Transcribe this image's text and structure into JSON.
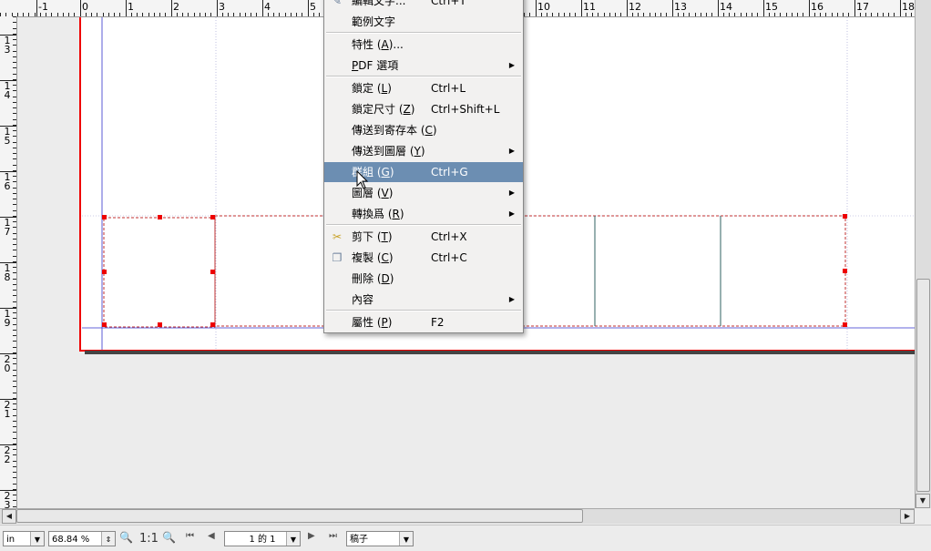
{
  "rulers": {
    "horizontal": [
      "-1",
      "0",
      "1",
      "2",
      "3",
      "4",
      "5",
      "10",
      "11",
      "12",
      "13",
      "14",
      "15",
      "16",
      "17",
      "18"
    ],
    "vertical": [
      "13",
      "14",
      "15",
      "16",
      "17",
      "18",
      "19",
      "20",
      "21",
      "22",
      "23"
    ]
  },
  "menu": {
    "items": [
      {
        "label": "編輯文字...",
        "shortcut": "Ctrl+T",
        "icon": "edit-text-icon",
        "submenu": false
      },
      {
        "label": "範例文字",
        "shortcut": "",
        "submenu": false
      },
      {
        "label": "特性 (A)...",
        "shortcut": "",
        "submenu": false
      },
      {
        "label": "PDF 選項",
        "shortcut": "",
        "submenu": true
      },
      {
        "label": "鎖定 (L)",
        "shortcut": "Ctrl+L",
        "submenu": false
      },
      {
        "label": "鎖定尺寸 (Z)",
        "shortcut": "Ctrl+Shift+L",
        "submenu": false
      },
      {
        "label": "傳送到寄存本 (C)",
        "shortcut": "",
        "submenu": false
      },
      {
        "label": "傳送到圖層 (Y)",
        "shortcut": "",
        "submenu": true
      },
      {
        "label": "群組 (G)",
        "shortcut": "Ctrl+G",
        "submenu": false,
        "highlighted": true
      },
      {
        "label": "圖層 (V)",
        "shortcut": "",
        "submenu": true
      },
      {
        "label": "轉換爲 (R)",
        "shortcut": "",
        "submenu": true
      },
      {
        "label": "剪下 (T)",
        "shortcut": "Ctrl+X",
        "icon": "cut-icon",
        "submenu": false
      },
      {
        "label": "複製 (C)",
        "shortcut": "Ctrl+C",
        "icon": "copy-icon",
        "submenu": false
      },
      {
        "label": "刪除 (D)",
        "shortcut": "",
        "submenu": false
      },
      {
        "label": "內容",
        "shortcut": "",
        "submenu": true
      },
      {
        "label": "屬性 (P)",
        "shortcut": "F2",
        "submenu": false
      }
    ]
  },
  "statusbar": {
    "unit": "in",
    "zoom": "68.84 %",
    "zoom_reset": "1:1",
    "page": "1 的 1",
    "layer": "稿子"
  },
  "colors": {
    "menu_highlight": "#6c8eb2",
    "page_border": "#e00000",
    "handle": "#e00000",
    "guide": "#3333cc"
  }
}
